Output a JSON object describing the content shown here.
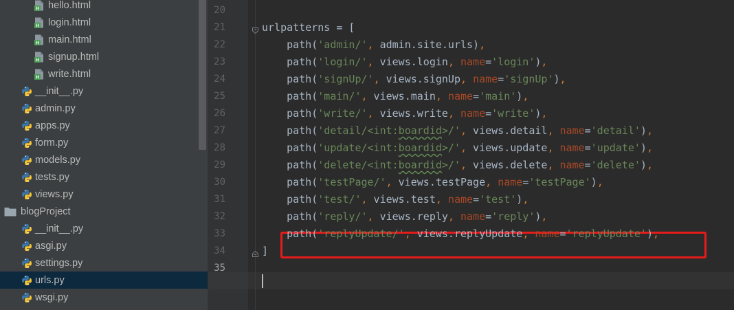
{
  "project_tree": {
    "items": [
      {
        "label": "hello.html",
        "type": "html",
        "indent": 2
      },
      {
        "label": "login.html",
        "type": "html",
        "indent": 2
      },
      {
        "label": "main.html",
        "type": "html",
        "indent": 2
      },
      {
        "label": "signup.html",
        "type": "html",
        "indent": 2
      },
      {
        "label": "write.html",
        "type": "html",
        "indent": 2
      },
      {
        "label": "__init__.py",
        "type": "py",
        "indent": 1
      },
      {
        "label": "admin.py",
        "type": "py",
        "indent": 1
      },
      {
        "label": "apps.py",
        "type": "py",
        "indent": 1
      },
      {
        "label": "form.py",
        "type": "py",
        "indent": 1
      },
      {
        "label": "models.py",
        "type": "py",
        "indent": 1
      },
      {
        "label": "tests.py",
        "type": "py",
        "indent": 1
      },
      {
        "label": "views.py",
        "type": "py",
        "indent": 1
      },
      {
        "label": "blogProject",
        "type": "folder",
        "indent": 0
      },
      {
        "label": "__init__.py",
        "type": "py",
        "indent": 1
      },
      {
        "label": "asgi.py",
        "type": "py",
        "indent": 1
      },
      {
        "label": "settings.py",
        "type": "py",
        "indent": 1
      },
      {
        "label": "urls.py",
        "type": "py",
        "indent": 1,
        "selected": true
      },
      {
        "label": "wsgi.py",
        "type": "py",
        "indent": 1
      }
    ]
  },
  "editor": {
    "current_line": "35",
    "lines": [
      {
        "num": "20",
        "code": ""
      },
      {
        "num": "21",
        "code": "urlpatterns = ["
      },
      {
        "num": "22",
        "code": "    path('admin/', admin.site.urls),"
      },
      {
        "num": "23",
        "code": "    path('login/', views.login, name='login'),"
      },
      {
        "num": "24",
        "code": "    path('signUp/', views.signUp, name='signUp'),"
      },
      {
        "num": "25",
        "code": "    path('main/', views.main, name='main'),"
      },
      {
        "num": "26",
        "code": "    path('write/', views.write, name='write'),"
      },
      {
        "num": "27",
        "code": "    path('detail/<int:boardid>/', views.detail, name='detail'),"
      },
      {
        "num": "28",
        "code": "    path('update/<int:boardid>/', views.update, name='update'),"
      },
      {
        "num": "29",
        "code": "    path('delete/<int:boardid>/', views.delete, name='delete'),"
      },
      {
        "num": "30",
        "code": "    path('testPage/', views.testPage, name='testPage'),"
      },
      {
        "num": "31",
        "code": "    path('test/', views.test, name='test'),"
      },
      {
        "num": "32",
        "code": "    path('reply/', views.reply, name='reply'),"
      },
      {
        "num": "33",
        "code": "    path('replyUpdate/', views.replyUpdate, name='replyUpdate'),"
      },
      {
        "num": "34",
        "code": "]"
      },
      {
        "num": "35",
        "code": ""
      }
    ]
  },
  "colors": {
    "string": "#6a8759",
    "keyword_arg": "#aa4926",
    "punctuation": "#cc7832",
    "identifier": "#a9b7c6",
    "highlight_box": "#e81b1b",
    "selection": "#0d293e"
  }
}
